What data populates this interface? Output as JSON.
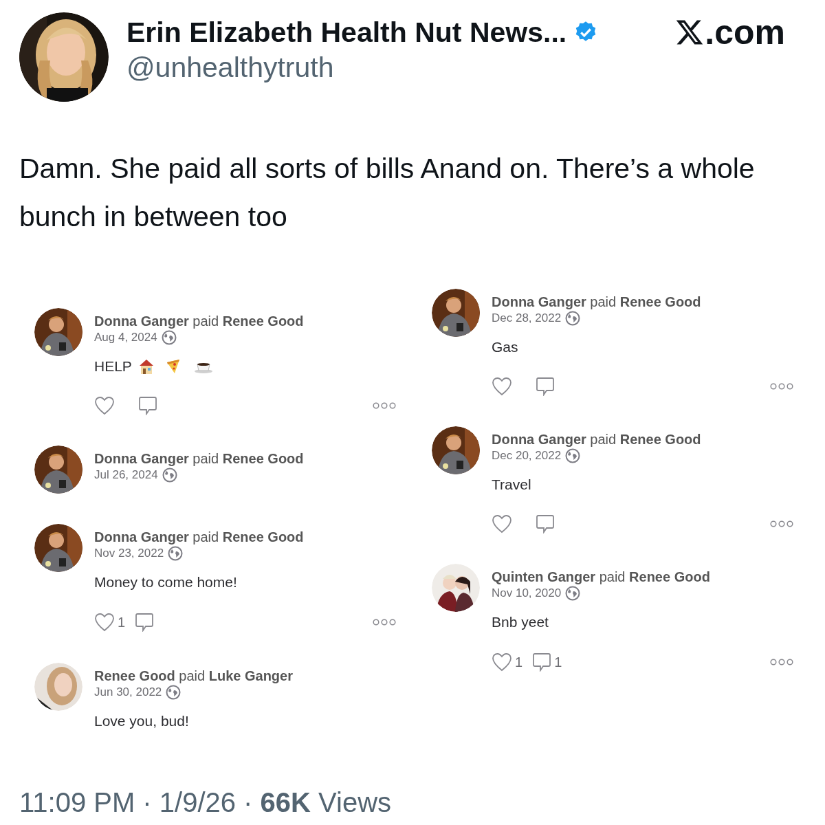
{
  "author": {
    "name": "Erin Elizabeth Health Nut News...",
    "verified": true,
    "handle": "@unhealthytruth"
  },
  "site": ".com",
  "tweet_text": "Damn. She paid all sorts of bills Anand on. There’s a whole bunch in between too",
  "payment_columns": [
    [
      {
        "kind": "payment_with_emoji",
        "title": "**Donna Ganger** paid **Renee Good**",
        "date": "Aug 4, 2024",
        "note": "HELP",
        "show_actions": true
      },
      {
        "kind": "payment",
        "title": "**Donna Ganger** paid **Renee Good**",
        "date": "Jul 26, 2024",
        "show_actions": false
      },
      {
        "kind": "payment",
        "title": "**Donna Ganger** paid **Renee Good**",
        "date": "Nov 23, 2022",
        "note": "Money to come home!",
        "show_actions": true,
        "likes": "1"
      },
      {
        "kind": "payment",
        "title": "**Renee Good** paid **Luke Ganger**",
        "date": "Jun 30, 2022",
        "note": "Love you, bud!",
        "show_actions": false
      }
    ],
    [
      {
        "kind": "payment",
        "title": "**Donna Ganger** paid **Renee Good**",
        "date": "Dec 28, 2022",
        "note": "Gas",
        "show_actions": true
      },
      {
        "kind": "payment",
        "title": "**Donna Ganger** paid **Renee Good**",
        "date": "Dec 20, 2022",
        "note": "Travel",
        "show_actions": true
      },
      {
        "kind": "payment",
        "title": "**Quinten Ganger** paid **Renee Good**",
        "date": "Nov 10, 2020",
        "note": "Bnb yeet",
        "show_actions": true,
        "likes": "1",
        "comments": "1"
      }
    ]
  ],
  "footer": "11:09 PM · 1/9/26 · **66K** Views"
}
